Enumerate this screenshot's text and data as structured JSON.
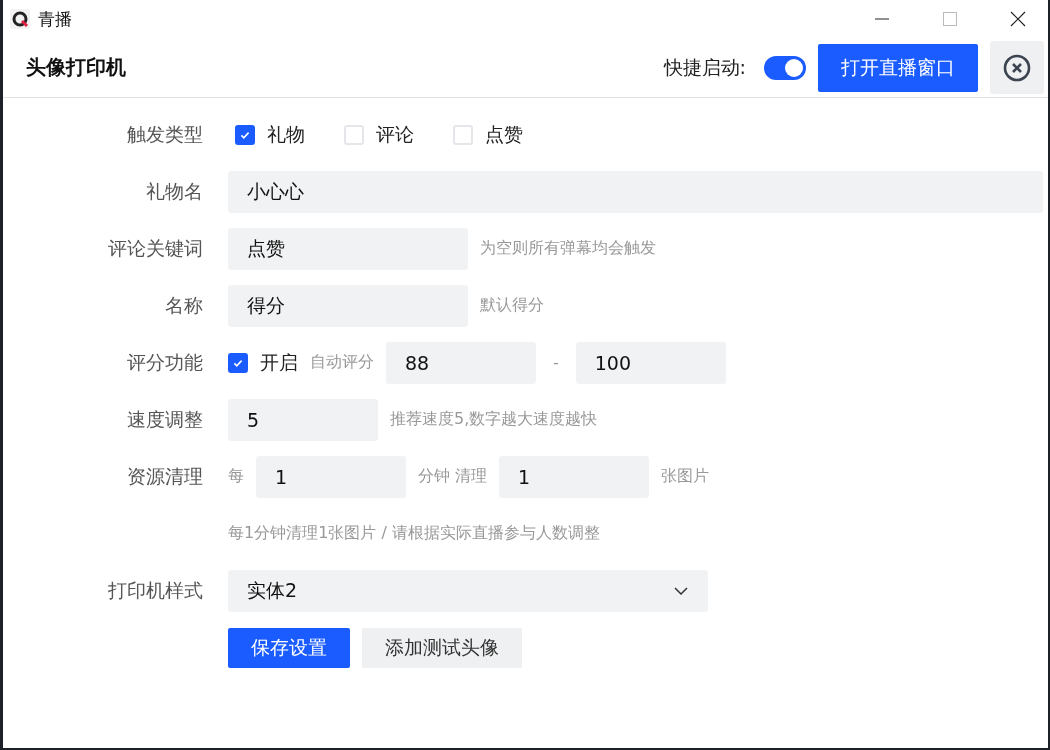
{
  "window": {
    "title": "青播"
  },
  "header": {
    "title": "头像打印机",
    "quick_start": {
      "label": "快捷启动:",
      "on": true
    },
    "open_button": "打开直播窗口"
  },
  "form": [
    {
      "kind": "checks",
      "label": "触发类型",
      "options": [
        {
          "label": "礼物",
          "checked": true
        },
        {
          "label": "评论",
          "checked": false
        },
        {
          "label": "点赞",
          "checked": false
        }
      ]
    },
    {
      "kind": "wide_input",
      "label": "礼物名",
      "value": "小心心"
    },
    {
      "kind": "input",
      "label": "评论关键词",
      "value": "点赞",
      "hint": "为空则所有弹幕均会触发"
    },
    {
      "kind": "input",
      "label": "名称",
      "value": "得分",
      "hint": "默认得分"
    },
    {
      "kind": "score",
      "label": "评分功能",
      "checked": true,
      "option": "开启",
      "sub": "自动评分",
      "min": "88",
      "separator": "-",
      "max": "100"
    },
    {
      "kind": "short_input",
      "label": "速度调整",
      "value": "5",
      "hint": "推荐速度5,数字越大速度越快"
    },
    {
      "kind": "cleanup",
      "label": "资源清理",
      "prefix": "每",
      "minutes": "1",
      "middle": "分钟 清理",
      "count": "1",
      "suffix": "张图片"
    },
    {
      "kind": "note",
      "text": "每1分钟清理1张图片 / 请根据实际直播参与人数调整"
    },
    {
      "kind": "select",
      "label": "打印机样式",
      "value": "实体2"
    }
  ],
  "buttons": [
    {
      "label": "保存设置",
      "primary": true
    },
    {
      "label": "添加测试头像",
      "primary": false
    }
  ]
}
